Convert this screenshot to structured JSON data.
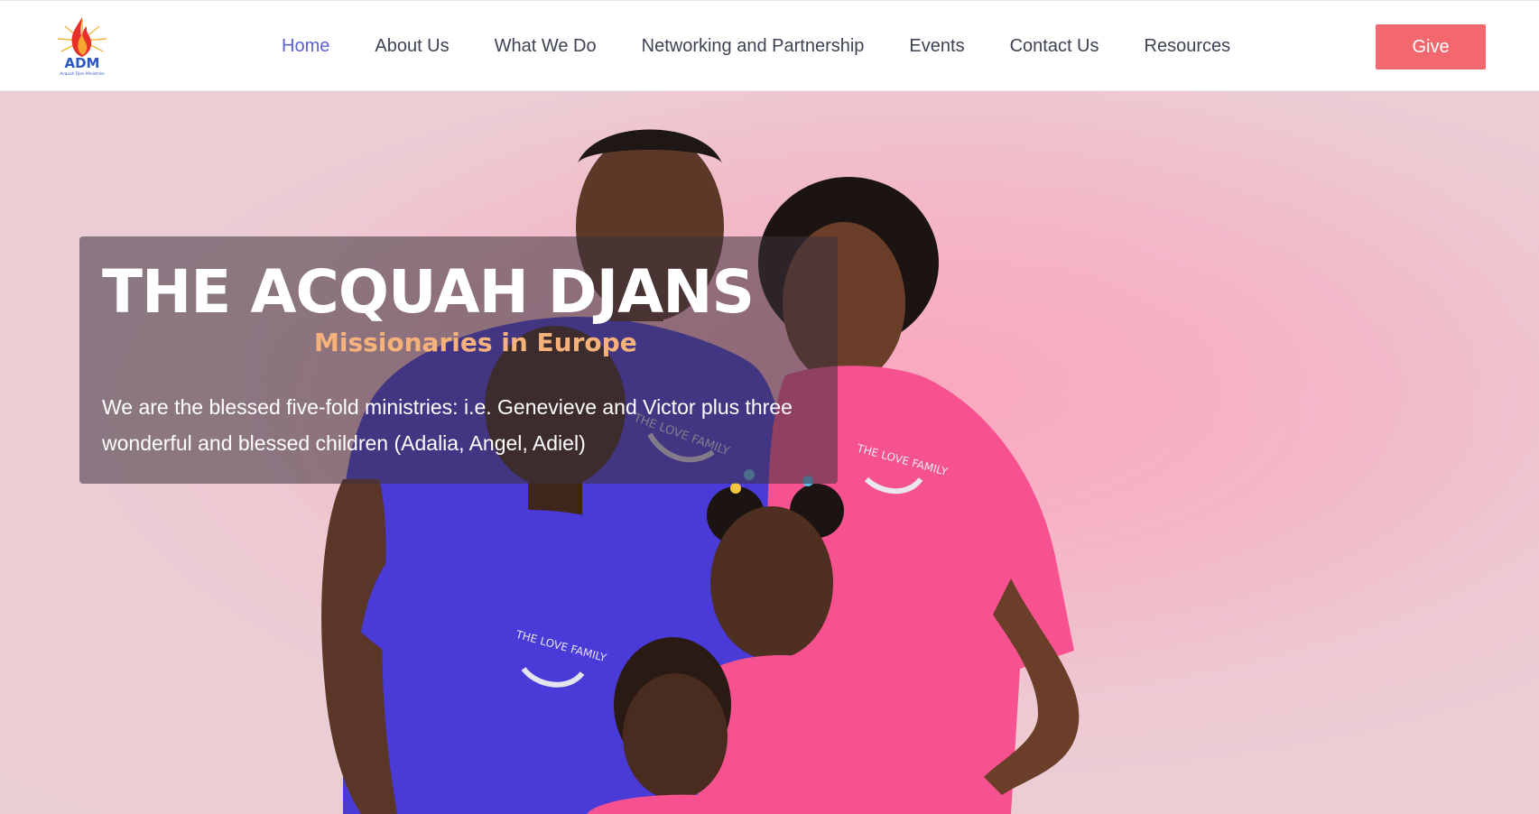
{
  "header": {
    "logo": {
      "icon": "adm-flame-logo-icon",
      "text": "ADM",
      "subtext": "Acquah Djan Ministries"
    },
    "nav": [
      {
        "label": "Home",
        "active": true
      },
      {
        "label": "About Us",
        "active": false
      },
      {
        "label": "What We Do",
        "active": false
      },
      {
        "label": "Networking and Partnership",
        "active": false
      },
      {
        "label": "Events",
        "active": false
      },
      {
        "label": "Contact Us",
        "active": false
      },
      {
        "label": "Resources",
        "active": false
      }
    ],
    "give_label": "Give"
  },
  "hero": {
    "title": "THE ACQUAH DJANS",
    "subtitle": "Missionaries in Europe",
    "description": "We are the blessed five-fold ministries: i.e. Genevieve and Victor plus three wonderful and blessed children (Adalia, Angel, Adiel)",
    "image": "family-photo",
    "shirt_print": "THE LOVE FAMILY"
  },
  "colors": {
    "nav_active": "#5b5fd6",
    "nav_text": "#3d4352",
    "give_button": "#f2686e",
    "subtitle": "#f6b27a",
    "hero_bg": "#efc3cf",
    "shirt_blue": "#4a3ad8",
    "shirt_pink": "#f5528f"
  }
}
